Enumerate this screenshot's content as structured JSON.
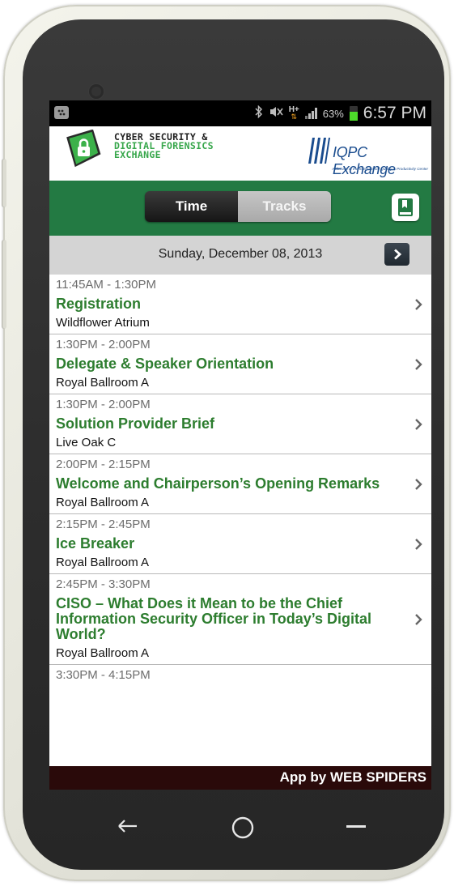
{
  "status_bar": {
    "battery_percent": "63%",
    "clock": "6:57 PM",
    "network_label": "H+",
    "icons": [
      "bbm-icon",
      "bluetooth-icon",
      "mute-icon",
      "data-arrows-icon",
      "signal-icon",
      "battery-icon"
    ]
  },
  "header": {
    "event_logo": {
      "line1": "CYBER SECURITY &",
      "line2": "DIGITAL FORENSICS",
      "line3": "EXCHANGE"
    },
    "organizer_logo": {
      "name": "IQPC Exchange",
      "tagline": "A division of the International Quality & Productivity Center"
    }
  },
  "toolbar": {
    "tabs": [
      {
        "label": "Time",
        "selected": true
      },
      {
        "label": "Tracks",
        "selected": false
      }
    ],
    "bookmark_icon": "bookmark-icon"
  },
  "date_nav": {
    "date": "Sunday, December 08, 2013",
    "next_icon": "chevron-right-icon"
  },
  "sessions": [
    {
      "time": "11:45AM - 1:30PM",
      "title": "Registration",
      "room": "Wildflower Atrium"
    },
    {
      "time": "1:30PM - 2:00PM",
      "title": "Delegate & Speaker Orientation",
      "room": "Royal Ballroom A"
    },
    {
      "time": "1:30PM - 2:00PM",
      "title": "Solution Provider Brief",
      "room": "Live Oak C"
    },
    {
      "time": "2:00PM - 2:15PM",
      "title": "Welcome and Chairperson’s Opening Remarks",
      "room": "Royal Ballroom A"
    },
    {
      "time": "2:15PM - 2:45PM",
      "title": "Ice Breaker",
      "room": "Royal Ballroom A"
    },
    {
      "time": "2:45PM - 3:30PM",
      "title": "CISO – What Does it Mean to be the Chief Information Security Officer in Today’s Digital World?",
      "room": "Royal Ballroom A"
    },
    {
      "time": "3:30PM - 4:15PM",
      "title": "",
      "room": ""
    }
  ],
  "footer": {
    "credit": "App by WEB SPIDERS"
  },
  "colors": {
    "toolbar_green": "#237a43",
    "title_green": "#2d7d2f",
    "date_bar": "#d4d4d4",
    "footer": "#2a0a0a",
    "battery_green": "#4ddc2a"
  },
  "nav_keys": [
    "back-icon",
    "home-icon",
    "menu-icon"
  ]
}
